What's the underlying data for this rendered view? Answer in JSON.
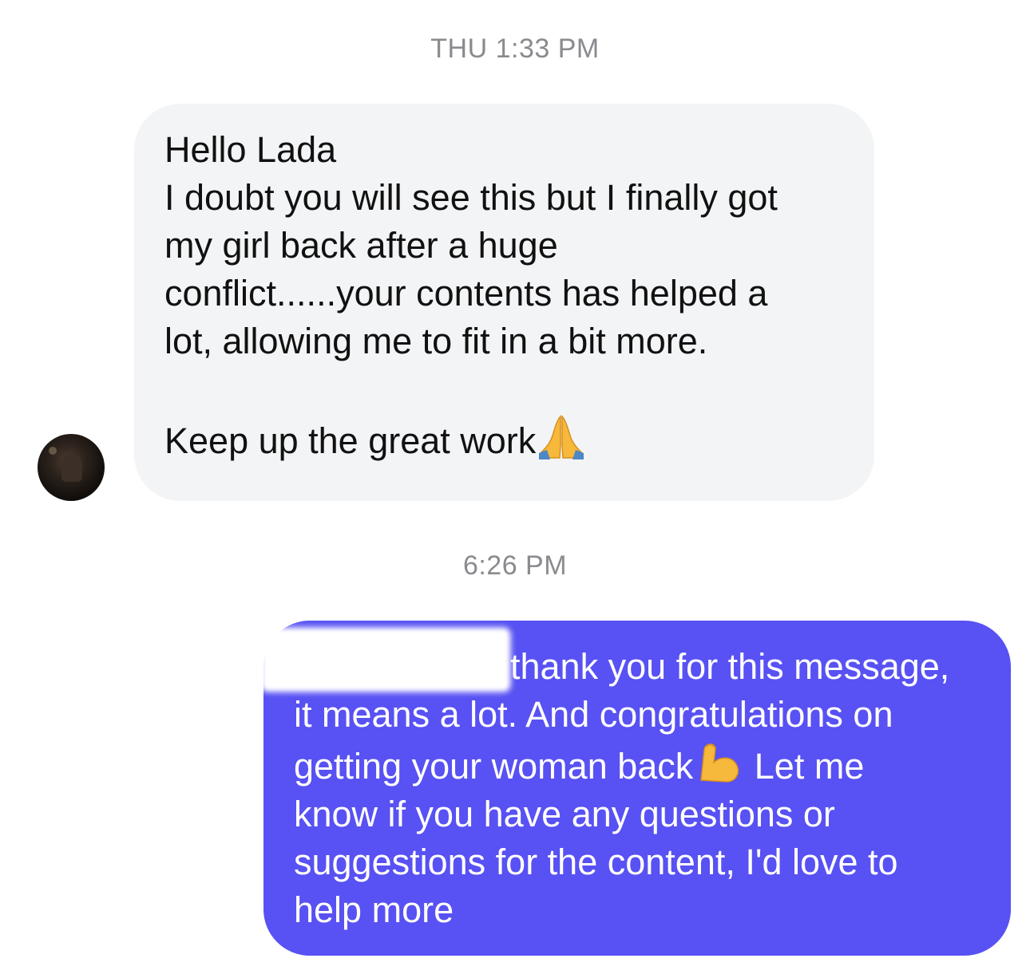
{
  "conversation": {
    "timestamp_1": "THU 1:33 PM",
    "incoming_message": {
      "line_1": "Hello Lada",
      "line_2": "I doubt you will see this but I finally got",
      "line_3": "my girl back after a huge",
      "line_4": "conflict......your contents has helped a",
      "line_5": "lot, allowing me to fit in a bit more.",
      "line_6": "Keep up the great work",
      "emoji": "folded-hands-icon"
    },
    "timestamp_2": "6:26 PM",
    "outgoing_message": {
      "line_1": ", thank you for this message,",
      "line_2": "it means a lot. And congratulations on",
      "line_3a": "getting your woman back",
      "line_3b": " Let me",
      "line_4": "know if you have any questions or",
      "line_5": "suggestions for the content, I'd love to",
      "line_6": "help more",
      "emoji": "flexed-biceps-icon",
      "redacted": true
    }
  },
  "colors": {
    "incoming_bubble": "#f3f4f6",
    "outgoing_bubble": "#5851f3",
    "timestamp_text": "#8a8a8f"
  }
}
